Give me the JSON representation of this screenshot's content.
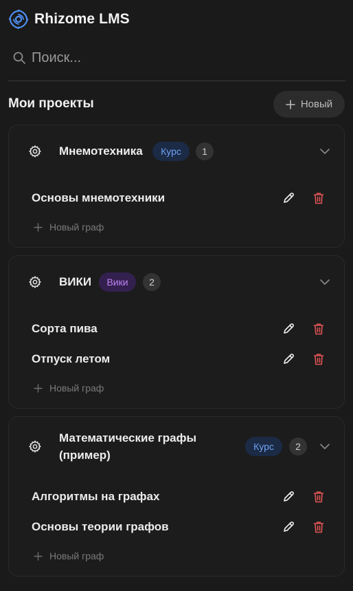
{
  "app": {
    "name": "Rhizome LMS"
  },
  "search": {
    "placeholder": "Поиск..."
  },
  "projects_section": {
    "title": "Мои проекты",
    "new_button": "Новый"
  },
  "projects": [
    {
      "name": "Мнемотехника",
      "badge": "Курс",
      "badge_color": "#6ea2f2",
      "count": "1",
      "graphs": [
        "Основы мнемотехники"
      ],
      "add_label": "Новый граф"
    },
    {
      "name": "ВИКИ",
      "badge": "Вики",
      "badge_color": "#bb83f0",
      "count": "2",
      "graphs": [
        "Сорта пива",
        "Отпуск летом"
      ],
      "add_label": "Новый граф"
    },
    {
      "name_line1": "Математические графы",
      "name_line2": "(пример)",
      "badge": "Курс",
      "badge_color": "#6ea2f2",
      "count": "2",
      "graphs": [
        "Алгоритмы на графах",
        "Основы теории графов"
      ],
      "add_label": "Новый граф"
    }
  ],
  "colors": {
    "background": "#1a1a1a",
    "delete": "#e05555",
    "logo": "#4f8ff0"
  }
}
